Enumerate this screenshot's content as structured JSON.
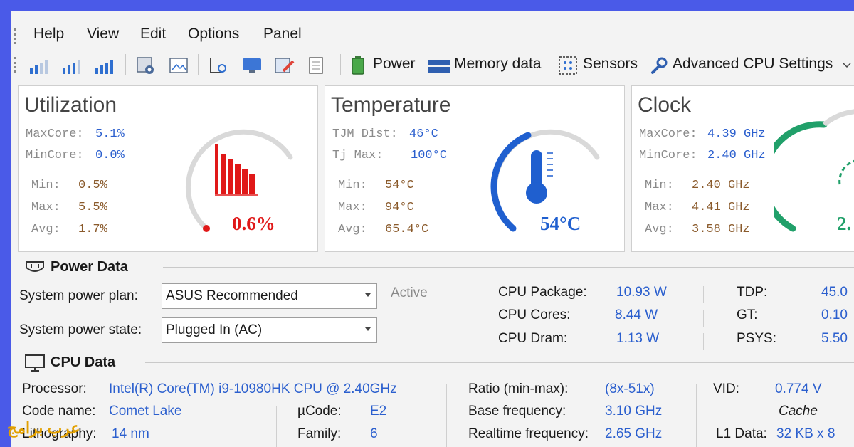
{
  "menu": {
    "items": [
      "Help",
      "View",
      "Edit",
      "Options",
      "Panel"
    ]
  },
  "toolbar": {
    "power_label": "Power",
    "memory_label": "Memory data",
    "sensors_label": "Sensors",
    "advanced_label": "Advanced CPU Settings"
  },
  "utilization": {
    "title": "Utilization",
    "max_core_label": "MaxCore:",
    "max_core_value": "5.1%",
    "min_core_label": "MinCore:",
    "min_core_value": "0.0%",
    "min_label": "Min:",
    "min_value": "0.5%",
    "max_label": "Max:",
    "max_value": "5.5%",
    "avg_label": "Avg:",
    "avg_value": "1.7%",
    "gauge_value": "0.6%",
    "gauge_fraction": 0.006
  },
  "temperature": {
    "title": "Temperature",
    "tjm_label": "TJM Dist:",
    "tjm_value": "46°C",
    "tjmax_label": "Tj Max:",
    "tjmax_value": "100°C",
    "min_label": "Min:",
    "min_value": "54°C",
    "max_label": "Max:",
    "max_value": "94°C",
    "avg_label": "Avg:",
    "avg_value": "65.4°C",
    "gauge_value": "54°C",
    "gauge_fraction": 0.54
  },
  "clock": {
    "title": "Clock",
    "max_core_label": "MaxCore:",
    "max_core_value": "4.39 GHz",
    "min_core_label": "MinCore:",
    "min_core_value": "2.40 GHz",
    "min_label": "Min:",
    "min_value": "2.40 GHz",
    "max_label": "Max:",
    "max_value": "4.41 GHz",
    "avg_label": "Avg:",
    "avg_value": "3.58 GHz",
    "gauge_value": "2."
  },
  "power_data": {
    "heading": "Power Data",
    "plan_label": "System power plan:",
    "plan_value": "ASUS Recommended",
    "plan_status": "Active",
    "state_label": "System power state:",
    "state_value": "Plugged In (AC)",
    "cpu_package_label": "CPU Package:",
    "cpu_package_value": "10.93 W",
    "cpu_cores_label": "CPU Cores:",
    "cpu_cores_value": "8.44 W",
    "cpu_dram_label": "CPU Dram:",
    "cpu_dram_value": "1.13 W",
    "tdp_label": "TDP:",
    "tdp_value": "45.0",
    "gt_label": "GT:",
    "gt_value": "0.10",
    "psys_label": "PSYS:",
    "psys_value": "5.50"
  },
  "cpu_data": {
    "heading": "CPU Data",
    "processor_label": "Processor:",
    "processor_value": "Intel(R) Core(TM) i9-10980HK CPU @ 2.40GHz",
    "codename_label": "Code name:",
    "codename_value": "Comet Lake",
    "litho_label": "Lithography:",
    "litho_value": "14 nm",
    "ucode_label": "µCode:",
    "ucode_value": "E2",
    "family_label": "Family:",
    "family_value": "6",
    "ratio_label": "Ratio (min-max):",
    "ratio_value": "(8x-51x)",
    "base_label": "Base frequency:",
    "base_value": "3.10 GHz",
    "realtime_label": "Realtime frequency:",
    "realtime_value": "2.65 GHz",
    "vid_label": "VID:",
    "vid_value": "0.774 V",
    "cache_label": "Cache",
    "l1_label": "L1 Data:",
    "l1_value": "32 KB x 8"
  },
  "watermark": "عرب برامج",
  "colors": {
    "accent_blue": "#1f5fcf",
    "gauge_red": "#e01818",
    "gauge_green": "#21a06a",
    "frame_blue": "#4a5ae8"
  }
}
